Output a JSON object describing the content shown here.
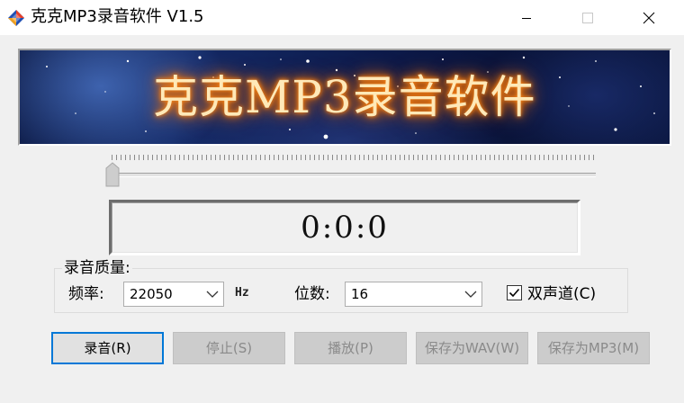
{
  "window": {
    "title": "克克MP3录音软件 V1.5",
    "controls": [
      "minimize",
      "maximize",
      "close"
    ]
  },
  "banner": {
    "title": "克克MP3录音软件"
  },
  "volume_slider": {
    "position": 0
  },
  "timer": {
    "value": "0:0:0"
  },
  "quality": {
    "group_label": "录音质量:",
    "frequency_label": "频率:",
    "frequency_value": "22050",
    "frequency_unit": "Hz",
    "bits_label": "位数:",
    "bits_value": "16",
    "stereo_label": "双声道(C)",
    "stereo_checked": true
  },
  "buttons": {
    "record": "录音(R)",
    "stop": "停止(S)",
    "play": "播放(P)",
    "save_wav": "保存为WAV(W)",
    "save_mp3": "保存为MP3(M)"
  },
  "colors": {
    "focus_border": "#0078d7",
    "banner_text_glow": "#ff7a00",
    "banner_background": "#0c1a4a"
  }
}
